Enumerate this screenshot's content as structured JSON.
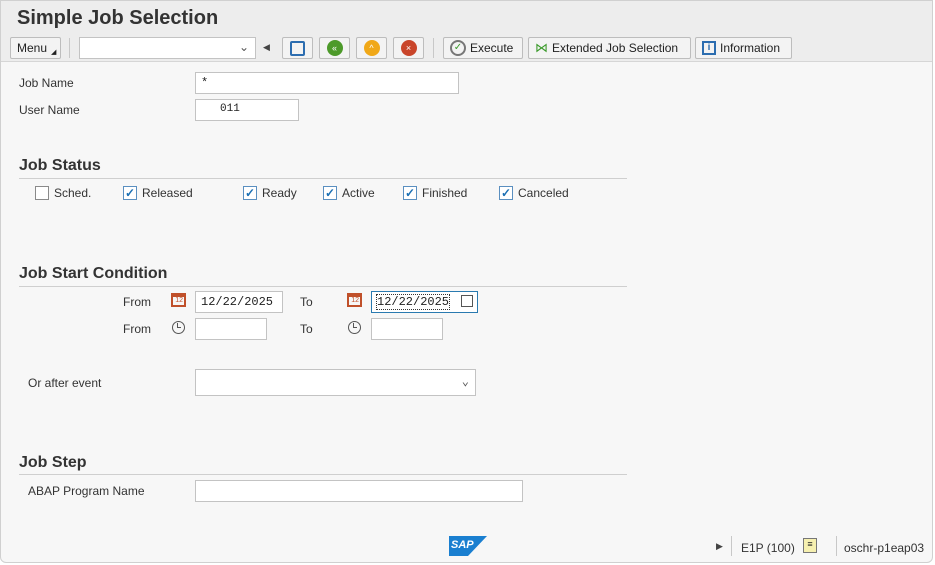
{
  "title": "Simple Job Selection",
  "toolbar": {
    "menu": "Menu",
    "command_value": "",
    "execute": "Execute",
    "extended": "Extended Job Selection",
    "information": "Information"
  },
  "fields": {
    "job_name_label": "Job Name",
    "job_name": "*",
    "user_name_label": "User Name",
    "user_name": "011"
  },
  "job_status": {
    "heading": "Job Status",
    "items": [
      {
        "label": "Sched.",
        "checked": false
      },
      {
        "label": "Released",
        "checked": true
      },
      {
        "label": "Ready",
        "checked": true
      },
      {
        "label": "Active",
        "checked": true
      },
      {
        "label": "Finished",
        "checked": true
      },
      {
        "label": "Canceled",
        "checked": true
      }
    ]
  },
  "start": {
    "heading": "Job Start Condition",
    "from": "From",
    "to": "To",
    "date_from": "12/22/2025",
    "date_to": "12/22/2025",
    "time_from": "",
    "time_to": "",
    "event_label": "Or after event",
    "event_value": ""
  },
  "step": {
    "heading": "Job Step",
    "abap_label": "ABAP Program Name",
    "abap_value": ""
  },
  "status": {
    "logo": "SAP",
    "system": "E1P (100)",
    "server": "oschr-p1eap03"
  },
  "check": "✓"
}
